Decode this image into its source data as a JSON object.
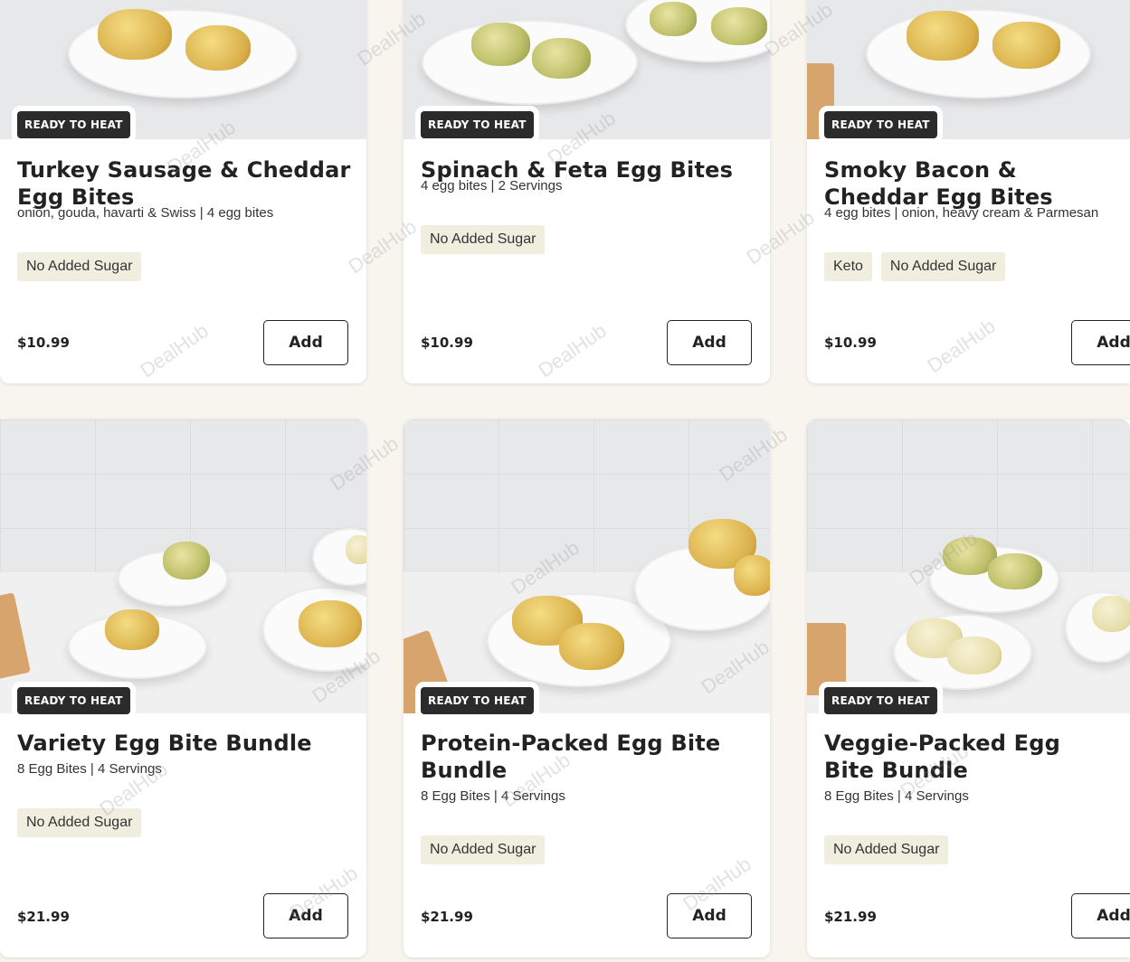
{
  "watermark": "DealHub",
  "colors": {
    "page_bg": "#f7f5ee",
    "badge_bg": "#2b2b2b",
    "tag_bg": "#efeedf",
    "card_bg": "#ffffff"
  },
  "products": [
    {
      "badge": "READY TO HEAT",
      "title": "Turkey Sausage & Cheddar Egg Bites",
      "desc": "onion, gouda, havarti & Swiss | 4 egg bites",
      "tags": [
        "No Added Sugar"
      ],
      "price": "$10.99",
      "add_label": "Add"
    },
    {
      "badge": "READY TO HEAT",
      "title": "Spinach & Feta Egg Bites",
      "desc": "4 egg bites | 2 Servings",
      "tags": [
        "No Added Sugar"
      ],
      "price": "$10.99",
      "add_label": "Add"
    },
    {
      "badge": "READY TO HEAT",
      "title": "Smoky Bacon & Cheddar Egg Bites",
      "desc": "4 egg bites | onion, heavy cream & Parmesan",
      "tags": [
        "Keto",
        "No Added Sugar"
      ],
      "price": "$10.99",
      "add_label": "Add"
    },
    {
      "badge": "READY TO HEAT",
      "title": "Variety Egg Bite Bundle",
      "desc": "8 Egg Bites | 4 Servings",
      "tags": [
        "No Added Sugar"
      ],
      "price": "$21.99",
      "add_label": "Add"
    },
    {
      "badge": "READY TO HEAT",
      "title": "Protein-Packed Egg Bite Bundle",
      "desc": "8 Egg Bites | 4 Servings",
      "tags": [
        "No Added Sugar"
      ],
      "price": "$21.99",
      "add_label": "Add"
    },
    {
      "badge": "READY TO HEAT",
      "title": "Veggie-Packed Egg Bite Bundle",
      "desc": "8 Egg Bites | 4 Servings",
      "tags": [
        "No Added Sugar"
      ],
      "price": "$21.99",
      "add_label": "Add"
    }
  ]
}
